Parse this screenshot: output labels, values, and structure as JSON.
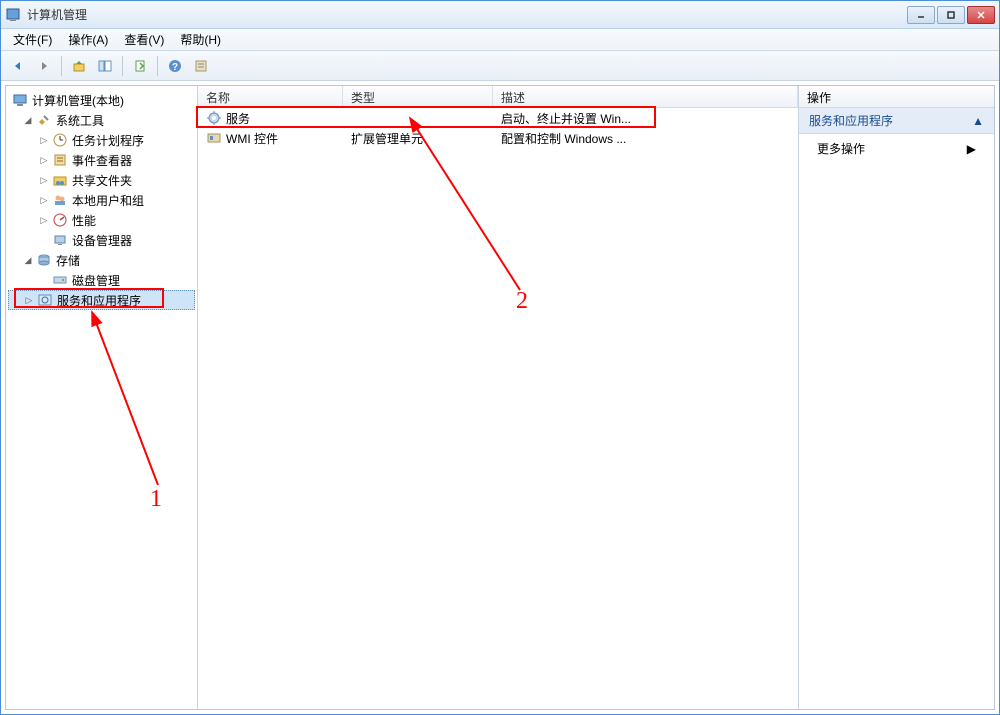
{
  "window": {
    "title": "计算机管理"
  },
  "menu": {
    "file": "文件(F)",
    "action": "操作(A)",
    "view": "查看(V)",
    "help": "帮助(H)"
  },
  "tree": {
    "root": "计算机管理(本地)",
    "system_tools": "系统工具",
    "task_scheduler": "任务计划程序",
    "event_viewer": "事件查看器",
    "shared_folders": "共享文件夹",
    "local_users": "本地用户和组",
    "performance": "性能",
    "device_manager": "设备管理器",
    "storage": "存储",
    "disk_management": "磁盘管理",
    "services_apps": "服务和应用程序"
  },
  "list": {
    "columns": {
      "name": "名称",
      "type": "类型",
      "description": "描述"
    },
    "col_widths": {
      "name": 145,
      "type": 150,
      "description": 300
    },
    "rows": [
      {
        "name": "服务",
        "type": "",
        "description": "启动、终止并设置 Win..."
      },
      {
        "name": "WMI 控件",
        "type": "扩展管理单元",
        "description": "配置和控制 Windows ..."
      }
    ]
  },
  "actions": {
    "header": "操作",
    "section": "服务和应用程序",
    "more": "更多操作"
  },
  "annotations": {
    "label1": "1",
    "label2": "2"
  }
}
